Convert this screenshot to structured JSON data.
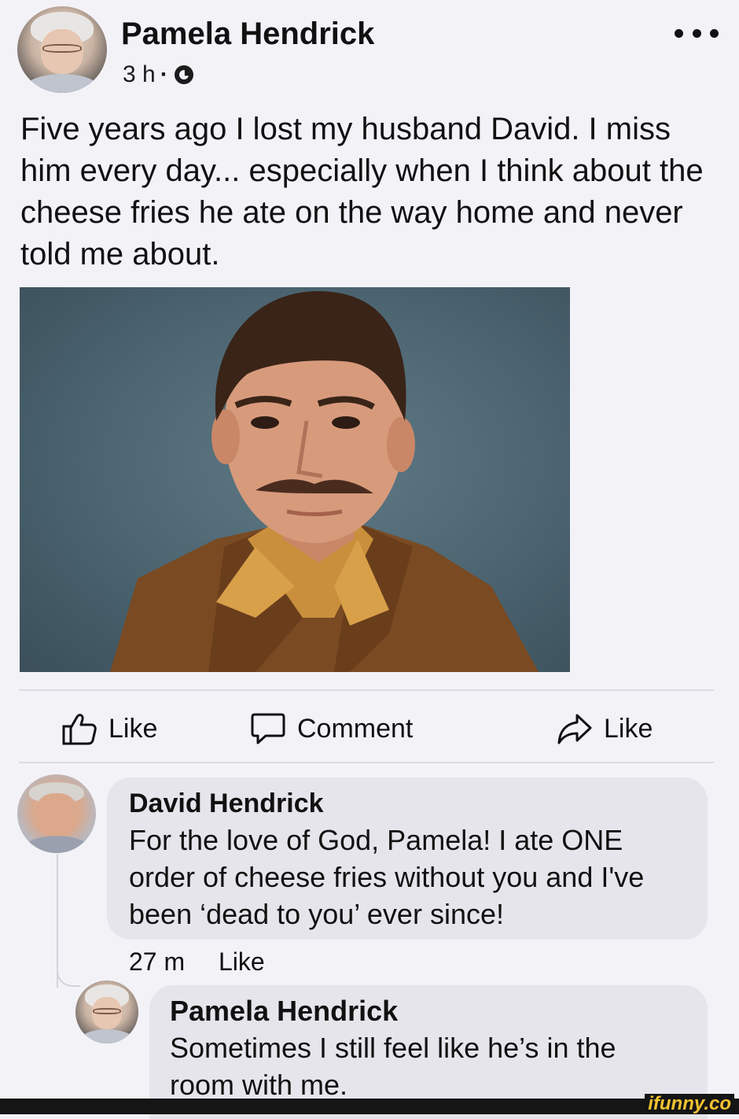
{
  "post": {
    "author": "Pamela Hendrick",
    "time": "3 h",
    "separator": "·",
    "audience_icon": "globe-icon",
    "text": "Five years ago I lost my husband David. I miss him every day... especially when I think about the cheese fries he ate on the way home and never told me about.",
    "menu_icon": "more-options-icon"
  },
  "actions": {
    "like_label": "Like",
    "comment_label": "Comment",
    "share_label": "Like"
  },
  "comments": [
    {
      "author": "David Hendrick",
      "text": "For the love of God, Pamela! I ate ONE order of cheese fries without you and I've been ‘dead to you’ ever since!",
      "time": "27 m",
      "like_label": "Like"
    },
    {
      "author": "Pamela Hendrick",
      "text": "Sometimes I still feel like he’s in the room with me."
    }
  ],
  "watermark": "ifunny.co",
  "colors": {
    "background": "#f3f2f7",
    "bubble": "#e6e5ec",
    "text": "#111111",
    "watermark": "#f2c230"
  }
}
